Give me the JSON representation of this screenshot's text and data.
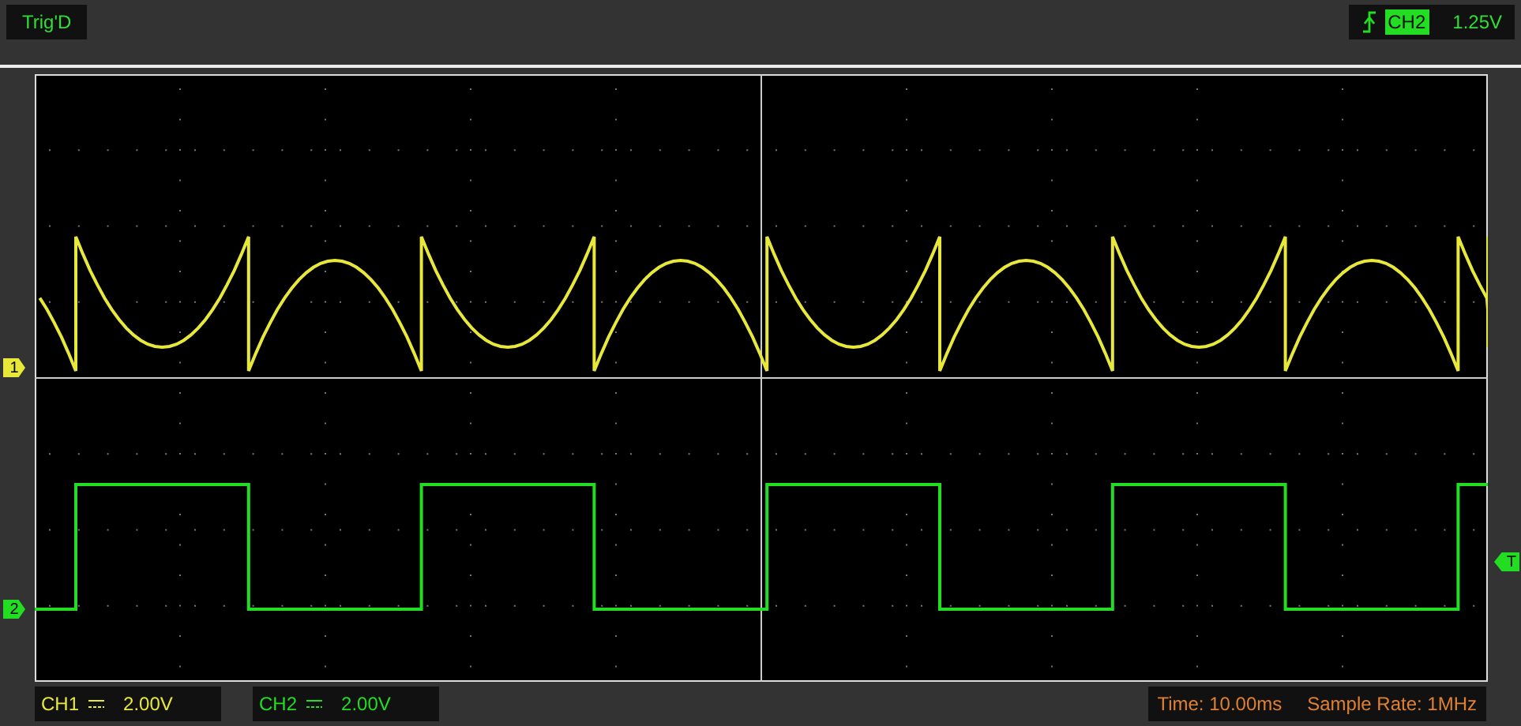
{
  "trigger_status": "Trig'D",
  "trigger": {
    "source": "CH2",
    "level": "1.25V"
  },
  "channels": [
    {
      "label": "CH1",
      "marker": "1",
      "color": "#e8e83a",
      "scale": "2.00V"
    },
    {
      "label": "CH2",
      "marker": "2",
      "color": "#22dd22",
      "scale": "2.00V"
    }
  ],
  "trigger_marker": "T",
  "timebase": "Time: 10.00ms",
  "sample_rate": "Sample Rate: 1MHz"
}
